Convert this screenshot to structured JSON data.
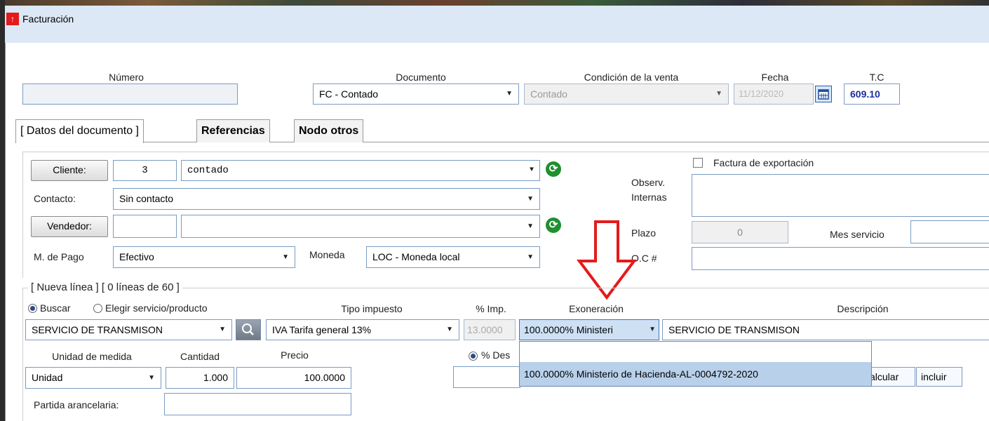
{
  "window": {
    "title": "Facturación",
    "logo_glyph": "↑"
  },
  "header": {
    "numero_label": "Número",
    "numero_value": "",
    "documento_label": "Documento",
    "documento_value": "FC - Contado",
    "condicion_label": "Condición de la venta",
    "condicion_value": "Contado",
    "fecha_label": "Fecha",
    "fecha_value": "11/12/2020",
    "tc_label": "T.C",
    "tc_value": "609.10"
  },
  "tabs": [
    {
      "label": "[ Datos del documento ]"
    },
    {
      "label": "Referencias"
    },
    {
      "label": "Nodo otros"
    }
  ],
  "form": {
    "cliente_button": "Cliente:",
    "cliente_code": "3",
    "cliente_name": "contado",
    "contacto_label": "Contacto:",
    "contacto_value": "Sin contacto",
    "vendedor_button": "Vendedor:",
    "vendedor_code": "",
    "vendedor_name": "",
    "mpago_label": "M. de Pago",
    "mpago_value": "Efectivo",
    "moneda_label": "Moneda",
    "moneda_value": "LOC - Moneda local",
    "export_label": "Factura de exportación",
    "observ_label_1": "Observ.",
    "observ_label_2": "Internas",
    "observ_value": "",
    "plazo_label": "Plazo",
    "plazo_value": "0",
    "mes_label": "Mes servicio",
    "mes_value": "",
    "oc_label": "O.C #",
    "oc_value": ""
  },
  "line": {
    "section_label": "[ Nueva línea ] [ 0 líneas de 60 ]",
    "buscar_label": "Buscar",
    "elegir_label": "Elegir servicio/producto",
    "tipo_label": "Tipo impuesto",
    "imp_label": "% Imp.",
    "exon_label": "Exoneración",
    "desc_label": "Descripción",
    "servicio_value": "SERVICIO DE TRANSMISON",
    "tipo_value": "IVA Tarifa general 13%",
    "imp_value": "13.0000",
    "exon_value": "100.0000% Ministeri",
    "desc_value": "SERVICIO DE TRANSMISON",
    "unidad_label": "Unidad de medida",
    "cantidad_label": "Cantidad",
    "precio_label": "Precio",
    "unidad_value": "Unidad",
    "cantidad_value": "1.000",
    "precio_value": "100.0000",
    "descuento_label": "% Des",
    "calcular_label": "alcular",
    "incluir_label": "incluir",
    "partida_label": "Partida arancelaria:",
    "partida_value": ""
  },
  "dropdown": {
    "options": [
      "",
      "100.0000% Ministerio de Hacienda-AL-0004792-2020"
    ],
    "selected": "100.0000% Ministerio de Hacienda-AL-0004792-2020"
  },
  "colors": {
    "arrow": "#e31b1b",
    "tc_text": "#1a2fa0",
    "highlight": "#b8d0ea",
    "refresh": "#1f8f2f"
  },
  "icons": {
    "dropdown": "▼",
    "refresh": "⟳",
    "search": "magnifier",
    "calendar": "calendar"
  }
}
